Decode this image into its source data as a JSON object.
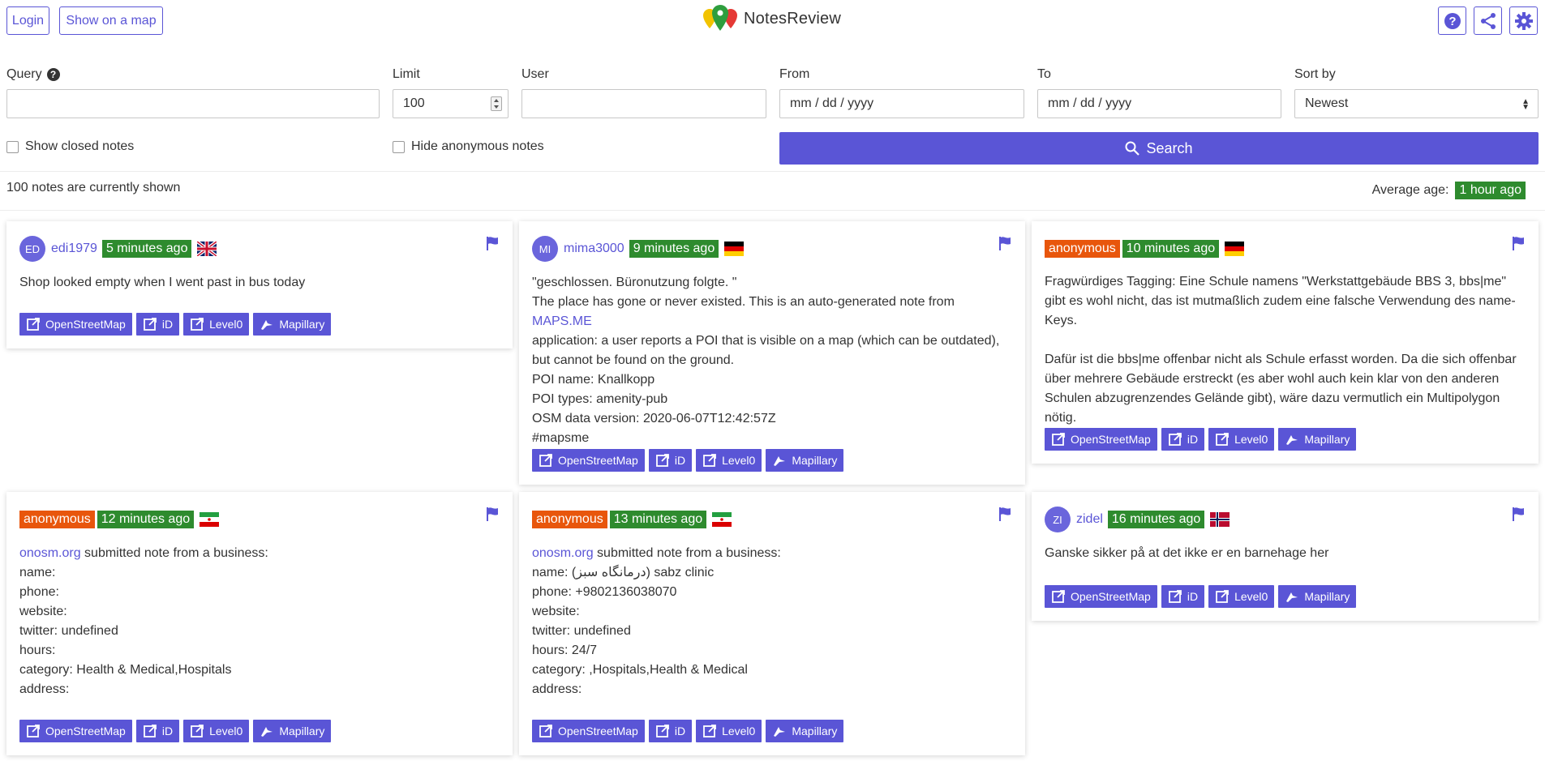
{
  "header": {
    "login_label": "Login",
    "map_label": "Show on a map",
    "app_name": "NotesReview",
    "help_icon": "question-icon",
    "share_icon": "share-icon",
    "settings_icon": "gear-icon"
  },
  "form": {
    "query_label": "Query",
    "query_value": "",
    "limit_label": "Limit",
    "limit_value": "100",
    "user_label": "User",
    "user_value": "",
    "from_label": "From",
    "from_placeholder": "mm / dd / yyyy",
    "to_label": "To",
    "to_placeholder": "mm / dd / yyyy",
    "sort_label": "Sort by",
    "sort_value": "Newest",
    "show_closed_label": "Show closed notes",
    "hide_anonymous_label": "Hide anonymous notes",
    "search_label": "Search"
  },
  "status": {
    "count_text": "100 notes are currently shown",
    "avg_label": "Average age:",
    "avg_value": "1 hour ago"
  },
  "colors": {
    "accent": "#5a55d6",
    "badge_green": "#2e8b2e",
    "badge_orange": "#e8560c"
  },
  "link_buttons": [
    "OpenStreetMap",
    "iD",
    "Level0",
    "Mapillary"
  ],
  "notes": [
    {
      "initials": "ED",
      "user": "edi1979",
      "anonymous": false,
      "age": "5 minutes ago",
      "country": "GB",
      "lines": [
        "Shop looked empty when I went past in bus today"
      ]
    },
    {
      "initials": "MI",
      "user": "mima3000",
      "anonymous": false,
      "age": "9 minutes ago",
      "country": "DE",
      "lines": [
        "\"geschlossen. Büronutzung folgte. \"",
        "The place has gone or never existed. This is an auto-generated note from ",
        "MAPS.ME",
        "application: a user reports a POI that is visible on a map (which can be outdated), but cannot be found on the ground.",
        "POI name: Knallkopp",
        "POI types: amenity-pub",
        "OSM data version: 2020-06-07T12:42:57Z",
        "#mapsme"
      ]
    },
    {
      "initials": "",
      "user": "anonymous",
      "anonymous": true,
      "age": "10 minutes ago",
      "country": "DE",
      "lines": [
        "Fragwürdiges Tagging: Eine Schule namens \"Werkstattgebäude BBS 3, bbs|me\" gibt es wohl nicht, das ist mutmaßlich zudem eine falsche Verwendung des name-Keys.",
        "",
        "Dafür ist die bbs|me offenbar nicht als Schule erfasst worden. Da die sich offenbar über mehrere Gebäude erstreckt (es aber wohl auch kein klar von den anderen Schulen abzugrenzendes Gelände gibt), wäre dazu vermutlich ein Multipolygon nötig."
      ]
    },
    {
      "initials": "",
      "user": "anonymous",
      "anonymous": true,
      "age": "12 minutes ago",
      "country": "IR",
      "lines": [
        "onosm.org",
        " submitted note from a business:",
        "name:",
        "phone:",
        "website:",
        "twitter: undefined",
        "hours:",
        "category: Health & Medical,Hospitals",
        "address:"
      ]
    },
    {
      "initials": "",
      "user": "anonymous",
      "anonymous": true,
      "age": "13 minutes ago",
      "country": "IR",
      "lines": [
        "onosm.org",
        " submitted note from a business:",
        "name: (درمانگاه سبز) sabz clinic",
        "phone: +9802136038070",
        "website:",
        "twitter: undefined",
        "hours: 24/7",
        "category: ,Hospitals,Health & Medical",
        "address:"
      ]
    },
    {
      "initials": "ZI",
      "user": "zidel",
      "anonymous": false,
      "age": "16 minutes ago",
      "country": "NO",
      "lines": [
        "Ganske sikker på at det ikke er en barnehage her"
      ]
    }
  ]
}
